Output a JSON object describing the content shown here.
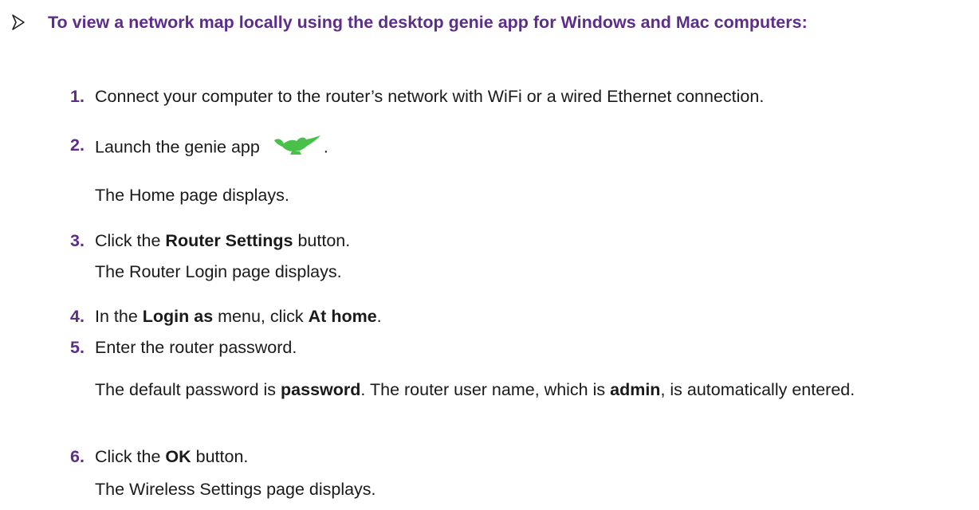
{
  "heading": "To view a network map locally using the desktop genie app for Windows and Mac computers:",
  "steps": [
    {
      "num": "1.",
      "text": "Connect your computer to the router’s network with WiFi or a wired Ethernet connection."
    },
    {
      "num": "2.",
      "pre": "Launch the genie app",
      "post": ".",
      "note": "The Home page displays."
    },
    {
      "num": "3.",
      "pre": "Click the ",
      "bold": "Router Settings",
      "post": " button.",
      "note": "The Router Login page displays."
    },
    {
      "num": "4.",
      "pre": "In the ",
      "bold1": "Login as",
      "mid": " menu, click ",
      "bold2": "At home",
      "post": "."
    },
    {
      "num": "5.",
      "text": "Enter the router password.",
      "note_pre": "The default password is ",
      "note_bold1": "password",
      "note_mid": ". The router user name, which is ",
      "note_bold2": "admin",
      "note_post": ", is automatically entered."
    },
    {
      "num": "6.",
      "pre": "Click the ",
      "bold": "OK",
      "post": " button.",
      "note": "The Wireless Settings page displays."
    }
  ],
  "icons": {
    "bullet": "arrow-bullet-icon",
    "app": "genie-lamp-icon"
  },
  "colors": {
    "accent": "#5c2d8a",
    "genie": "#49c04a"
  }
}
